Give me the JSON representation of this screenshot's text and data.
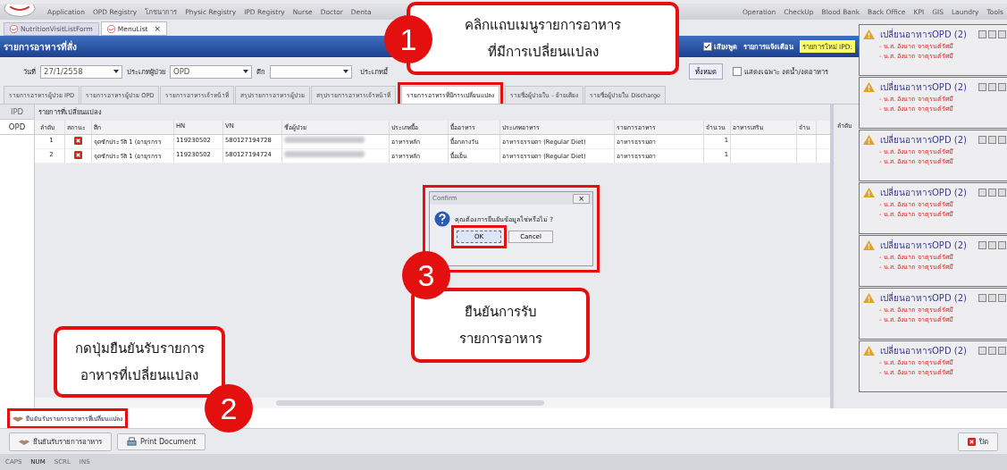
{
  "menu_bar": {
    "left_items": [
      "Application",
      "OPD Registry",
      "โภชนาการ",
      "Physic Registry",
      "IPD Registry",
      "Nurse",
      "Doctor",
      "Denta"
    ],
    "right_items": [
      "Operation",
      "CheckUp",
      "Blood Bank",
      "Back Office",
      "KPI",
      "GIS",
      "Laundry",
      "Tools"
    ]
  },
  "document_tabs": [
    {
      "label": "NutritionVisitListForm",
      "selected": false
    },
    {
      "label": "MenuList",
      "selected": true,
      "close": "×"
    }
  ],
  "title_bar": {
    "title": "รายการอาหารที่สั่ง",
    "sound": {
      "label": "เสียงพูด",
      "checked": true
    },
    "alert_label": "รายการแจ้งเตือน",
    "alert_value": "รายการใหม่ IPD:"
  },
  "filters": {
    "date": {
      "label": "วันที่",
      "value": "27/1/2558"
    },
    "patient_type": {
      "label": "ประเภทผู้ป่วย",
      "value": "OPD"
    },
    "ward": {
      "label": "ตึก"
    },
    "meal_type_label": "ประเภทมื้",
    "all_button": "ทั้งหมด",
    "only_fasting": {
      "label": "แสดงเฉพาะ งดน้ำ/งดอาหาร",
      "checked": false
    }
  },
  "tabs": [
    {
      "label": "รายการอาหารผู้ป่วย IPD",
      "selected": false
    },
    {
      "label": "รายการอาหารผู้ป่วย OPD",
      "selected": false
    },
    {
      "label": "รายการอาหารเจ้าหน้าที่",
      "selected": false
    },
    {
      "label": "สรุปรายการอาหารผู้ป่วย",
      "selected": false
    },
    {
      "label": "สรุปรายการอาหารเจ้าหน้าที่",
      "selected": false
    },
    {
      "label": "รายการอาหารที่มีการเปลี่ยนแปลง",
      "selected": true
    },
    {
      "label": "รายชื่อผู้ป่วยใน - ย้ายเตียง",
      "selected": false
    },
    {
      "label": "รายชื่อผู้ป่วยใน Discharge",
      "selected": false
    }
  ],
  "side_tabs": [
    {
      "label": "IPD",
      "selected": false
    },
    {
      "label": "OPD",
      "selected": true
    }
  ],
  "table": {
    "title": "รายการที่เปลี่ยนแปลง",
    "columns": [
      "ลำดับ",
      "สถานะ",
      "ตึก",
      "HN",
      "VN",
      "ชื่อผู้ป่วย",
      "ประเภทมื้อ",
      "มื้ออาหาร",
      "ประเภทอาหาร",
      "รายการอาหาร",
      "จำนวน",
      "อาหารเสริม",
      "จำน"
    ],
    "rows": [
      [
        "1",
        "",
        "จุดซักประวัติ 1 (อายุรกรร",
        "119230502",
        "580127194728",
        "",
        "อาหารหลัก",
        "มื้อกลางวัน",
        "อาหารธรรมดา (Regular Diet)",
        "อาหารธรรมดา",
        "1",
        "",
        ""
      ],
      [
        "2",
        "",
        "จุดซักประวัติ 1 (อายุรกรร",
        "119230502",
        "580127194724",
        "",
        "อาหารหลัก",
        "มื้อเย็น",
        "อาหารธรรมดา (Regular Diet)",
        "อาหารธรรมดา",
        "1",
        "",
        ""
      ]
    ]
  },
  "right_panel": {
    "column_1": "ลำดับ"
  },
  "notifications": [
    {
      "title": "เปลี่ยนอาหารOPD (2)",
      "lines": [
        "- น.ส. อังนาถ จาตุรนต์รัศมี",
        "- น.ส. อังนาถ จาตุรนต์รัศมี"
      ]
    },
    {
      "title": "เปลี่ยนอาหารOPD (2)",
      "lines": [
        "- น.ส. อังนาถ จาตุรนต์รัศมี",
        "- น.ส. อังนาถ จาตุรนต์รัศมี"
      ]
    },
    {
      "title": "เปลี่ยนอาหารOPD (2)",
      "lines": [
        "- น.ส. อังนาถ จาตุรนต์รัศมี",
        "- น.ส. อังนาถ จาตุรนต์รัศมี"
      ]
    },
    {
      "title": "เปลี่ยนอาหารOPD (2)",
      "lines": [
        "- น.ส. อังนาถ จาตุรนต์รัศมี",
        "- น.ส. อังนาถ จาตุรนต์รัศมี"
      ]
    },
    {
      "title": "เปลี่ยนอาหารOPD (2)",
      "lines": [
        "- น.ส. อังนาถ จาตุรนต์รัศมี",
        "- น.ส. อังนาถ จาตุรนต์รัศมี"
      ]
    },
    {
      "title": "เปลี่ยนอาหารOPD (2)",
      "lines": [
        "- น.ส. อังนาถ จาตุรนต์รัศมี",
        "- น.ส. อังนาถ จาตุรนต์รัศมี"
      ]
    },
    {
      "title": "เปลี่ยนอาหารOPD (2)",
      "lines": [
        "- น.ส. อังนาถ จาตุรนต์รัศมี",
        "- น.ส. อังนาถ จาตุรนต์รัศมี"
      ]
    }
  ],
  "dialog": {
    "title": "Confirm",
    "close": "×",
    "message": "คุณต้องการยืนยันข้อมูลใช่หรือไม่ ?",
    "buttons": [
      "OK",
      "Cancel"
    ]
  },
  "confirm_link": "ยืนยันรับรายการอาหารที่เปลี่ยนแปลง",
  "buttons": {
    "confirm": "ยืนยันรับรายการอาหาร",
    "print": "Print Document",
    "close": "ปิด"
  },
  "status_bar": [
    {
      "label": "CAPS",
      "on": false
    },
    {
      "label": "NUM",
      "on": true
    },
    {
      "label": "SCRL",
      "on": false
    },
    {
      "label": "INS",
      "on": false
    }
  ],
  "callouts": [
    {
      "number": "1",
      "lines": [
        "คลิกแถบเมนูรายการอาหาร",
        "ที่มีการเปลี่ยนแปลง"
      ]
    },
    {
      "number": "2",
      "lines": [
        "กดปุ่มยืนยันรับรายการ",
        "อาหารที่เปลี่ยนแปลง"
      ]
    },
    {
      "number": "3",
      "lines": [
        "ยืนยันการรับ",
        "รายการอาหาร"
      ]
    }
  ]
}
